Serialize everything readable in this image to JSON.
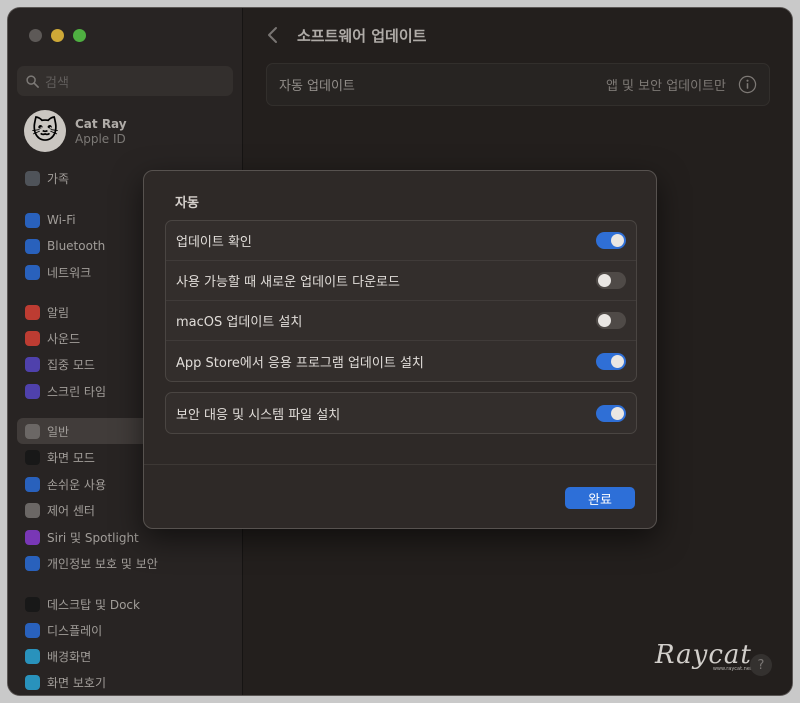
{
  "window": {
    "sidebar": {
      "search_placeholder": "검색",
      "profile": {
        "name": "Cat Ray",
        "subtitle": "Apple ID",
        "avatar_emoji": "🐱"
      },
      "items": [
        {
          "label": "가족",
          "icon": "family-icon",
          "color": "#5a5f66"
        },
        {
          "label": "Wi-Fi",
          "icon": "wifi-icon",
          "color": "#2f6fd6"
        },
        {
          "label": "Bluetooth",
          "icon": "bluetooth-icon",
          "color": "#2f6fd6"
        },
        {
          "label": "네트워크",
          "icon": "network-icon",
          "color": "#2f6fd6"
        },
        {
          "label": "알림",
          "icon": "bell-icon",
          "color": "#d8453a"
        },
        {
          "label": "사운드",
          "icon": "speaker-icon",
          "color": "#d8453a"
        },
        {
          "label": "집중 모드",
          "icon": "moon-icon",
          "color": "#5b4bc4"
        },
        {
          "label": "스크린 타임",
          "icon": "hourglass-icon",
          "color": "#5b4bc4"
        },
        {
          "label": "일반",
          "icon": "gear-icon",
          "color": "#7a7673"
        },
        {
          "label": "화면 모드",
          "icon": "appearance-icon",
          "color": "#1c1c1c"
        },
        {
          "label": "손쉬운 사용",
          "icon": "accessibility-icon",
          "color": "#2f6fd6"
        },
        {
          "label": "제어 센터",
          "icon": "control-center-icon",
          "color": "#7a7673"
        },
        {
          "label": "Siri 및 Spotlight",
          "icon": "siri-icon",
          "color": "#8a3fd0"
        },
        {
          "label": "개인정보 보호 및 보안",
          "icon": "hand-icon",
          "color": "#2f6fd6"
        },
        {
          "label": "데스크탑 및 Dock",
          "icon": "dock-icon",
          "color": "#1c1c1c"
        },
        {
          "label": "디스플레이",
          "icon": "display-icon",
          "color": "#2f6fd6"
        },
        {
          "label": "배경화면",
          "icon": "wallpaper-icon",
          "color": "#2fa7d6"
        },
        {
          "label": "화면 보호기",
          "icon": "screensaver-icon",
          "color": "#2fa7d6"
        }
      ],
      "selected": "일반"
    },
    "main": {
      "title": "소프트웨어 업데이트",
      "auto_update_label": "자동 업데이트",
      "auto_update_value": "앱 및 보안 업데이트만",
      "help": "?"
    },
    "watermark": {
      "main": "Raycat",
      "sub": "www.raycat.net"
    }
  },
  "dialog": {
    "title": "자동",
    "group1": [
      {
        "label": "업데이트 확인",
        "on": true
      },
      {
        "label": "사용 가능할 때 새로운 업데이트 다운로드",
        "on": false
      },
      {
        "label": "macOS 업데이트 설치",
        "on": false
      },
      {
        "label": "App Store에서 응용 프로그램 업데이트 설치",
        "on": true
      }
    ],
    "group2": [
      {
        "label": "보안 대응 및 시스템 파일 설치",
        "on": true
      }
    ],
    "done_label": "완료"
  }
}
